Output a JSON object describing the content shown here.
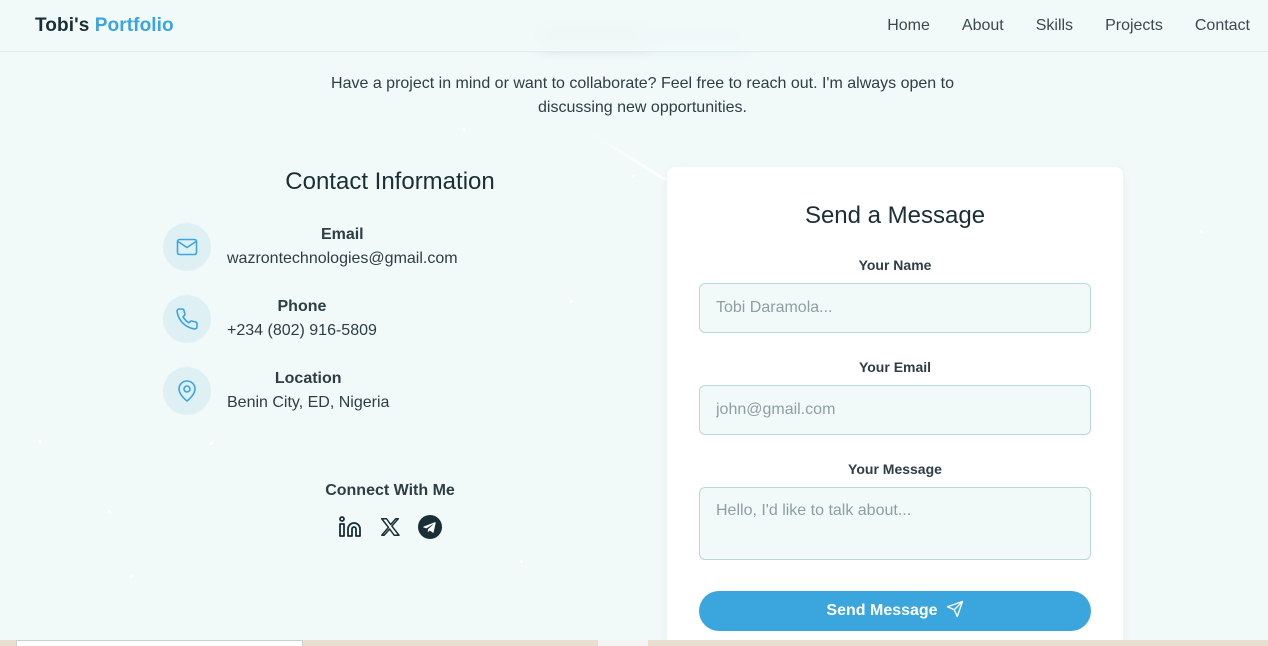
{
  "brand": {
    "first": "Tobi's",
    "second": "Portfolio"
  },
  "nav": [
    "Home",
    "About",
    "Skills",
    "Projects",
    "Contact"
  ],
  "intro": {
    "line1": "Have a project in mind or want to collaborate? Feel free to reach out. I'm always open to",
    "line2": "discussing new opportunities."
  },
  "contact_info": {
    "title": "Contact Information",
    "items": [
      {
        "label": "Email",
        "value": "wazrontechnologies@gmail.com",
        "icon": "mail-icon"
      },
      {
        "label": "Phone",
        "value": "+234 (802) 916-5809",
        "icon": "phone-icon"
      },
      {
        "label": "Location",
        "value": "Benin City, ED, Nigeria",
        "icon": "map-pin-icon"
      }
    ],
    "connect_title": "Connect With Me",
    "social": [
      "linkedin-icon",
      "x-icon",
      "telegram-icon"
    ]
  },
  "form": {
    "title": "Send a Message",
    "name_label": "Your Name",
    "name_placeholder": "Tobi Daramola...",
    "email_label": "Your Email",
    "email_placeholder": "john@gmail.com",
    "message_label": "Your Message",
    "message_placeholder": "Hello, I'd like to talk about...",
    "submit_label": "Send Message",
    "submit_icon": "send-icon"
  },
  "colors": {
    "accent": "#3aa6dd",
    "text_dark": "#1a2e35",
    "background": "#f1f9f9",
    "icon_bg": "#dff0f5",
    "field_border": "#b9d9d6"
  }
}
